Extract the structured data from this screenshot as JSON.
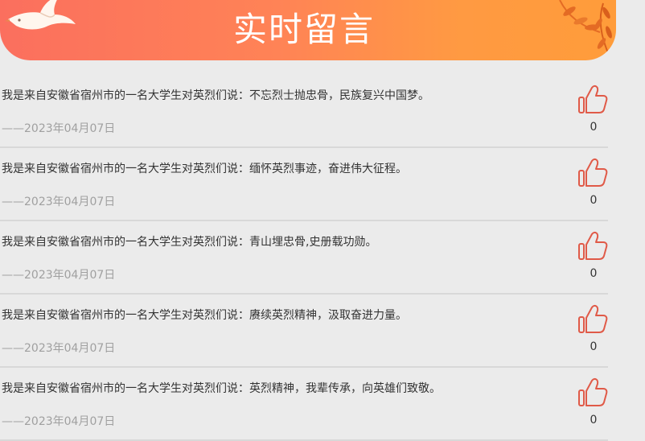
{
  "header": {
    "title": "实时留言"
  },
  "messages": [
    {
      "text": "我是来自安徽省宿州市的一名大学生对英烈们说：不忘烈士抛忠骨，民族复兴中国梦。",
      "date": "——2023年04月07日",
      "likes": "0"
    },
    {
      "text": "我是来自安徽省宿州市的一名大学生对英烈们说：缅怀英烈事迹，奋进伟大征程。",
      "date": "——2023年04月07日",
      "likes": "0"
    },
    {
      "text": "我是来自安徽省宿州市的一名大学生对英烈们说：青山埋忠骨,史册载功勋。",
      "date": "——2023年04月07日",
      "likes": "0"
    },
    {
      "text": "我是来自安徽省宿州市的一名大学生对英烈们说：赓续英烈精神，汲取奋进力量。",
      "date": "——2023年04月07日",
      "likes": "0"
    },
    {
      "text": "我是来自安徽省宿州市的一名大学生对英烈们说：英烈精神，我辈传承，向英雄们致敬。",
      "date": "——2023年04月07日",
      "likes": "0"
    }
  ],
  "icons": {
    "like": "thumbs-up-icon",
    "banner_left": "dove-icon",
    "banner_right": "leaves-icon"
  },
  "colors": {
    "banner_start": "#fb6f5e",
    "banner_end": "#ff9c3a",
    "like_icon": "#e05a48",
    "background": "#ebebeb"
  }
}
